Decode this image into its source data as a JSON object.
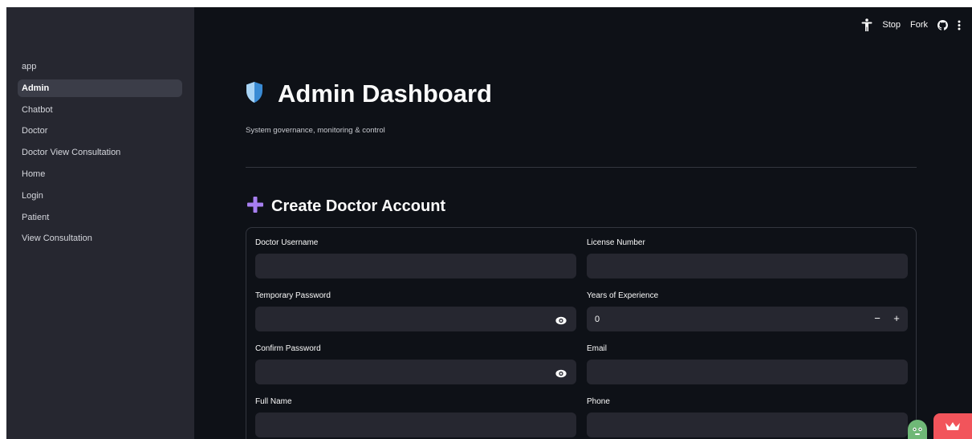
{
  "topbar": {
    "stop_label": "Stop",
    "fork_label": "Fork",
    "icons": [
      "accessibility-icon",
      "github-icon",
      "more-vertical-icon"
    ]
  },
  "sidebar": {
    "items": [
      {
        "label": "app",
        "active": false
      },
      {
        "label": "Admin",
        "active": true
      },
      {
        "label": "Chatbot",
        "active": false
      },
      {
        "label": "Doctor",
        "active": false
      },
      {
        "label": "Doctor View Consultation",
        "active": false
      },
      {
        "label": "Home",
        "active": false
      },
      {
        "label": "Login",
        "active": false
      },
      {
        "label": "Patient",
        "active": false
      },
      {
        "label": "View Consultation",
        "active": false
      }
    ]
  },
  "page": {
    "title": "Admin Dashboard",
    "title_icon": "shield-icon",
    "subtitle": "System governance, monitoring & control"
  },
  "section": {
    "title": "Create Doctor Account",
    "icon": "plus-icon"
  },
  "form": {
    "doctor_username": {
      "label": "Doctor Username",
      "value": ""
    },
    "license_number": {
      "label": "License Number",
      "value": ""
    },
    "temporary_password": {
      "label": "Temporary Password",
      "value": ""
    },
    "years_of_experience": {
      "label": "Years of Experience",
      "value": "0",
      "decrement": "−",
      "increment": "+"
    },
    "confirm_password": {
      "label": "Confirm Password",
      "value": ""
    },
    "email": {
      "label": "Email",
      "value": ""
    },
    "full_name": {
      "label": "Full Name",
      "value": ""
    },
    "phone": {
      "label": "Phone",
      "value": ""
    }
  },
  "colors": {
    "background": "#0e1117",
    "sidebar": "#262730",
    "input": "#262730",
    "accent_plus": "#a77ff0",
    "shield_light": "#a9d4f5",
    "shield_dark": "#3a8bd4",
    "fab_red": "#f2545b"
  }
}
